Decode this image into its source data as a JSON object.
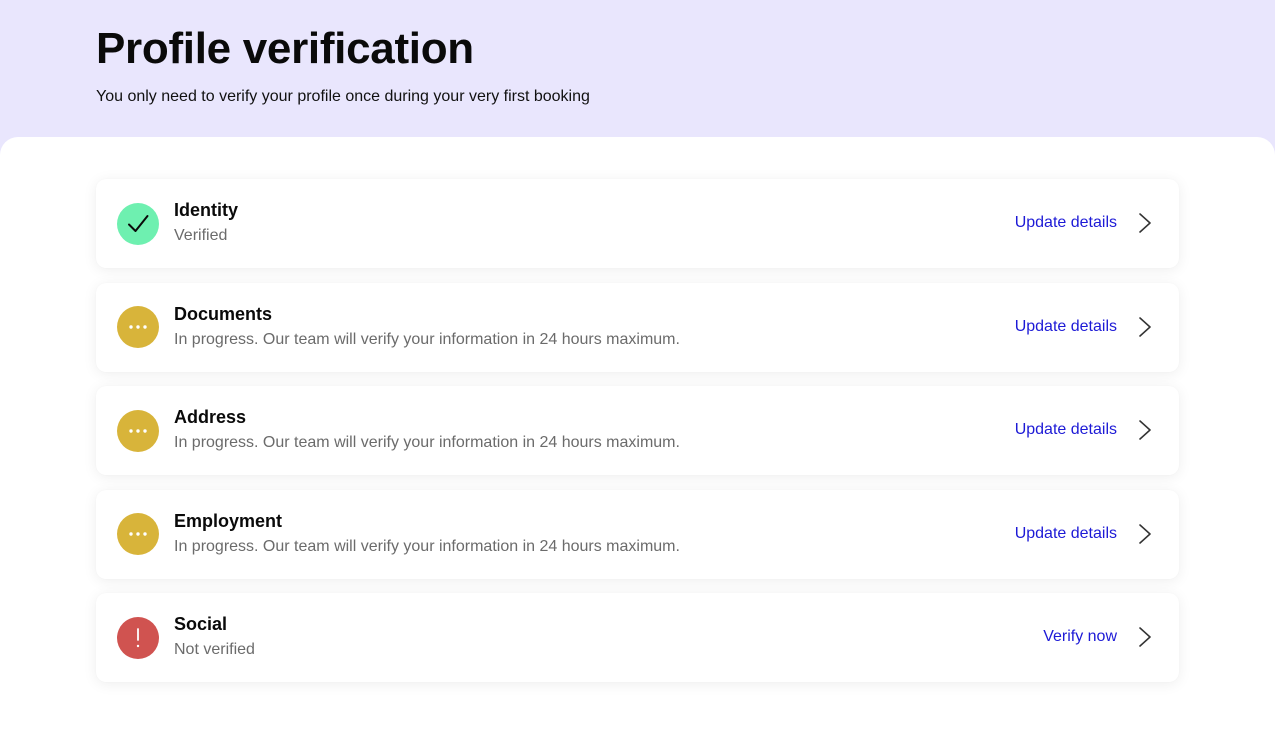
{
  "header": {
    "title": "Profile verification",
    "subtitle": "You only need to verify your profile once during your very first booking"
  },
  "items": [
    {
      "title": "Identity",
      "description": "Verified",
      "status": "verified",
      "status_icon": "check-icon",
      "status_color": "#6ef0b0",
      "action_label": "Update details"
    },
    {
      "title": "Documents",
      "description": "In progress. Our team will verify your information in 24 hours maximum.",
      "status": "in-progress",
      "status_icon": "more-dots-icon",
      "status_color": "#d8b43a",
      "action_label": "Update details"
    },
    {
      "title": "Address",
      "description": "In progress. Our team will verify your information in 24 hours maximum.",
      "status": "in-progress",
      "status_icon": "more-dots-icon",
      "status_color": "#d8b43a",
      "action_label": "Update details"
    },
    {
      "title": "Employment",
      "description": "In progress. Our team will verify your information in 24 hours maximum.",
      "status": "in-progress",
      "status_icon": "more-dots-icon",
      "status_color": "#d8b43a",
      "action_label": "Update details"
    },
    {
      "title": "Social",
      "description": "Not verified",
      "status": "not-verified",
      "status_icon": "exclamation-icon",
      "status_color": "#d05350",
      "action_label": "Verify now"
    }
  ],
  "colors": {
    "header_bg": "#e9e6fd",
    "link": "#1d1ad6",
    "verified": "#6ef0b0",
    "in_progress": "#d8b43a",
    "not_verified": "#d05350"
  }
}
